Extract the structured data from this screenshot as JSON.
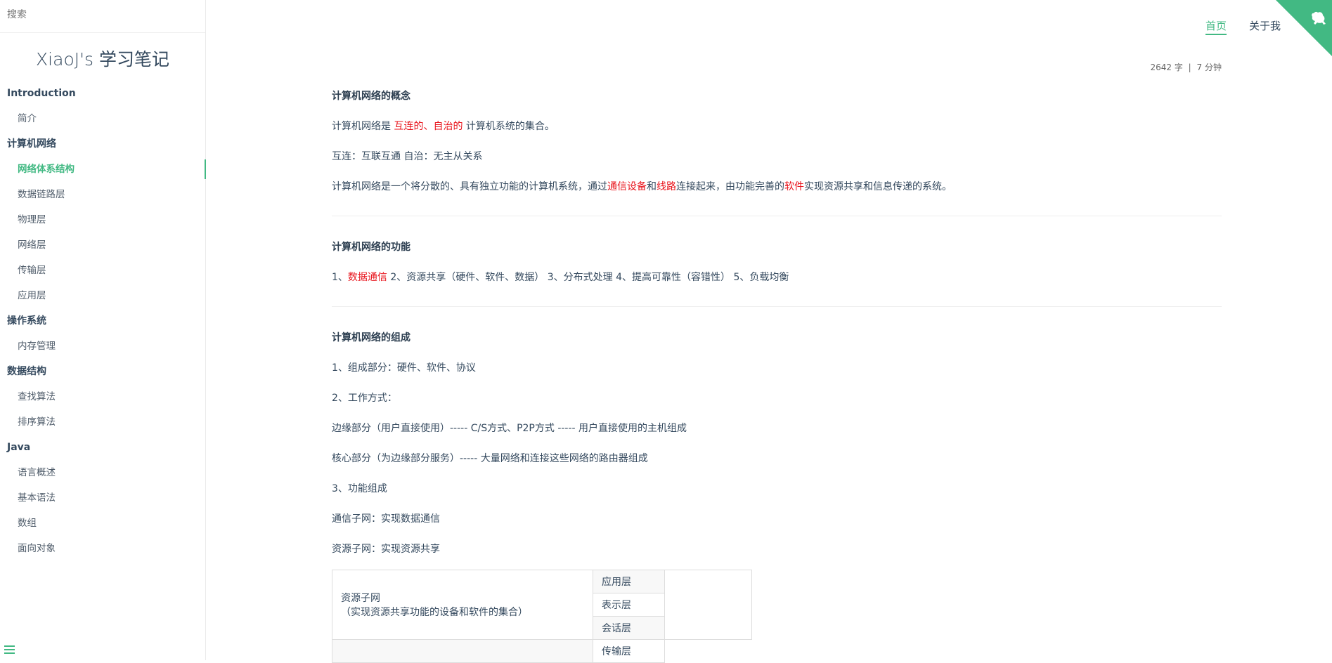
{
  "search": {
    "placeholder": "搜索"
  },
  "app_name": "XiaoJ's 学习笔记",
  "sidebar": {
    "groups": [
      {
        "title": "Introduction",
        "items": [
          "简介"
        ]
      },
      {
        "title": "计算机网络",
        "items": [
          "网络体系结构",
          "数据链路层",
          "物理层",
          "网络层",
          "传输层",
          "应用层"
        ]
      },
      {
        "title": "操作系统",
        "items": [
          "内存管理"
        ]
      },
      {
        "title": "数据结构",
        "items": [
          "查找算法",
          "排序算法"
        ]
      },
      {
        "title": "Java",
        "items": [
          "语言概述",
          "基本语法",
          "数组",
          "面向对象"
        ]
      }
    ],
    "active_item": "网络体系结构"
  },
  "top_nav": {
    "home": "首页",
    "about": "关于我"
  },
  "meta": {
    "words": "2642 字",
    "separator": "|",
    "time": "7 分钟"
  },
  "colors": {
    "accent": "#42b983",
    "highlight": "#e8121a"
  },
  "article": {
    "s1_title": "计算机网络的概念",
    "s1_p1_a": "计算机网络是 ",
    "s1_p1_b": "互连的、自治的",
    "s1_p1_c": " 计算机系统的集合。",
    "s1_p2": "互连：互联互通 自治：无主从关系",
    "s1_p3_a": "计算机网络是一个将分散的、具有独立功能的计算机系统，通过",
    "s1_p3_b": "通信设备",
    "s1_p3_c": "和",
    "s1_p3_d": "线路",
    "s1_p3_e": "连接起来，由功能完善的",
    "s1_p3_f": "软件",
    "s1_p3_g": "实现资源共享和信息传递的系统。",
    "s2_title": "计算机网络的功能",
    "s2_p1_a": "1、",
    "s2_p1_b": "数据通信",
    "s2_p1_c": " 2、资源共享（硬件、软件、数据） 3、分布式处理 4、提高可靠性（容错性） 5、负载均衡",
    "s3_title": "计算机网络的组成",
    "s3_p1": "1、组成部分：硬件、软件、协议",
    "s3_p2": "2、工作方式：",
    "s3_p3": "边缘部分（用户直接使用）----- C/S方式、P2P方式 ----- 用户直接使用的主机组成",
    "s3_p4": "核心部分（为边缘部分服务）----- 大量网络和连接这些网络的路由器组成",
    "s3_p5": "3、功能组成",
    "s3_p6": "通信子网：实现数据通信",
    "s3_p7": "资源子网：实现资源共享"
  },
  "table": {
    "group1_line1": "资源子网",
    "group1_line2": "（实现资源共享功能的设备和软件的集合）",
    "layers": [
      "应用层",
      "表示层",
      "会话层",
      "传输层"
    ]
  }
}
